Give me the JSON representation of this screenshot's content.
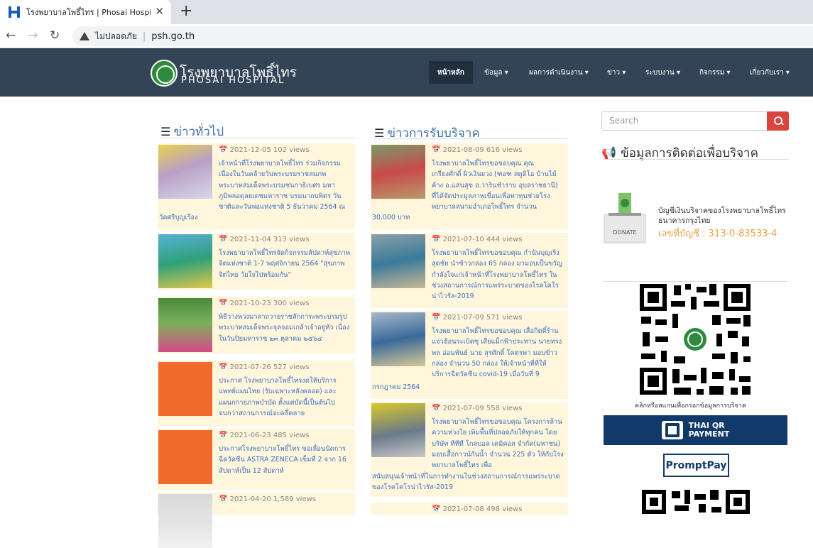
{
  "browser": {
    "tab_title": "โรงพยาบาลโพธิ์ไทร | Phosai Hospital",
    "insecure_label": "ไม่ปลอดภัย",
    "url": "psh.go.th"
  },
  "site": {
    "brand_th": "โรงพยาบาลโพธิ์ไทร",
    "brand_en": "PHOSAI HOSPITAL",
    "menu": [
      "หน้าหลัก",
      "ข้อมูล ▾",
      "ผลการดำเนินงาน ▾",
      "ข่าว ▾",
      "ระบบงาน ▾",
      "กิจกรรม ▾",
      "เกี่ยวกับเรา ▾"
    ]
  },
  "news_general": {
    "title": "ข่าวทั่วไป",
    "items": [
      {
        "meta": "📅 2021-12-05 102 views",
        "text": "เจ้าหน้าที่โรงพยาบาลโพธิ์ไทร ร่วมกิจกรรมเนื่องในวันคล้ายวันพระบรมราชสมภพ พระบาทสมเด็จพระบรมชนกาธิเบศร มหาภูมิพลอดุลยเดชมหาราช บรมนาถบพิตร วันชาติและวันพ่อแห่งชาติ 5 ธันวาคม 2564 ณ",
        "tail": "วัดศรีบุญเรือง"
      },
      {
        "meta": "📅 2021-11-04 313 views",
        "text": "โรงพยาบาลโพธิ์ไทรจัดกิจกรรมสัปดาห์สุขภาพจิตแห่งชาติ 1-7 พฤศจิกายน 2564 \"สุขภาพจิตไทย วัยใจไปพร้อมกัน\""
      },
      {
        "meta": "📅 2021-10-23 300 views",
        "text": "พิธีวางพวงมาลาถวายราชสักการะพระบรมรูป พระบาทสมเด็จพระจุลจอมเกล้าเจ้าอยู่หัว เนื่องในวันปิยมหาราช ๒๓ ตุลาคม ๒๕๖๔"
      },
      {
        "meta": "📅 2021-07-26 527 views",
        "text": "ประกาศ โรงพยาบาลโพธิ์ไทรงดให้บริการแพทย์แผนไทย (รับเฉพาะหลังคลอด) และแผนกกายภาพบำบัด ตั้งแต่บัดนี้เป็นต้นไปจนกว่าสถานการณ์จะคลี่คลาย"
      },
      {
        "meta": "📅 2021-06-23 485 views",
        "text": "ประกาศโรงพยาบาลโพธิ์ไทร ขอเลื่อนนัดการฉีดวัคซีน ASTRA ZENECA เข็มที่ 2 จาก 16 สัปดาห์เป็น 12 สัปดาห์"
      },
      {
        "meta": "📅 2021-04-20 1,589 views",
        "text": ""
      }
    ]
  },
  "news_donation": {
    "title": "ข่าวการรับบริจาค",
    "items": [
      {
        "meta": "📅 2021-08-09 616 views",
        "text": "โรงพยาบาลโพธิ์ไทรขอขอบคุณ คุณเกรียงศักดิ์ ผิวเงินยวง (ฑอฑ สตูดิโอ บ้านไม้ค้าง อ.แสนสุข อ.วารินชำราบ อุบลราชธานี) ที่ได้จัดประมูลภาพเขื่อนเพื่อหาทุนช่วยโรงพยาบาลสนามอำเภอโพธิ์ไทร จำนวน",
        "tail": "30,000 บาท"
      },
      {
        "meta": "📅 2021-07-10 444 views",
        "text": "โรงพยาบาลโพธิ์ไทรขอขอบคุณ กำนันบุญเริง สุดชัย นำข้าวกล่อง 65 กล่อง มามอบเป็นขวัญกำลังใจแก่เจ้าหน้าที่โรงพยาบาลโพธิ์ไทร ในช่วงสถานการณ์การแพร่ระบาดของโรคโคโรน่าไวรัส-2019"
      },
      {
        "meta": "📅 2021-07-09 571 views",
        "text": "โรงพยาบาลโพธิ์ไทรขอขอบคุณ เสื่อกิตติ์ร้านแจ่วฮ้อนระเบิดซุ เสี่ยแม็กฟ้าประทาน นายทรงพล อ่อนพันธ์ นาย สุรศักดิ์ โคตรพา มอบข้าวกล่อง จำนวน 50 กล่อง ให้เจ้าหน้าที่ที่ให้บริการฉีดวัคซีน covid-19 เมื่อวันที่ 9",
        "tail": "กรกฎาคม 2564"
      },
      {
        "meta": "📅 2021-07-09 558 views",
        "text": "โรงพยาบาลโพธิ์ไทรขอขอบคุณ โครงการล้านความห่วงใย เพิ่มพื้นที่ปลอดภัยให้ทุกคน โดย บริษัท ทีทีที โกลบอล เคมิคอล จำกัด(มหาชน) มอบเสื้อกาวน์กันน้ำ จำนวน 225 ตัว ให้กับโรงพยาบาลโพธิ์ไทร เพื่อ",
        "tail": "สนับสนุนเจ้าหน้าที่ในการทำงานในช่วงสถานการณ์การแพร่ระบาดของโรคโคโรน่าไวรัส-2019"
      },
      {
        "meta": "📅 2021-07-08 498 views",
        "text": ""
      }
    ]
  },
  "sidebar": {
    "search_placeholder": "Search",
    "contact_title": "ข้อมูลการติดต่อเพื่อบริจาค",
    "donate_label": "DONATE",
    "account_name": "บัญชีเงินบริจาคของโรงพยาบาลโพธิ์ไทร ธนาคารกรุงไทย",
    "account_no": "เลขที่บัญชี : 313-0-83533-4",
    "qr_caption": "คลิกหรือสแกนเพื่อกรอกข้อมูลการบริจาค",
    "thaiqr_label_1": "THAI QR",
    "thaiqr_label_2": "PAYMENT",
    "promptpay": "PromptPay"
  },
  "colors": {
    "header": "#334456",
    "card_bg": "#fff6dc",
    "link": "#3b6fc2",
    "search_btn": "#d9453d"
  }
}
